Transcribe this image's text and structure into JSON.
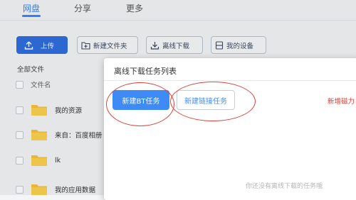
{
  "nav": {
    "tabs": [
      {
        "label": "网盘",
        "active": true
      },
      {
        "label": "分享",
        "active": false
      },
      {
        "label": "更多",
        "active": false
      }
    ]
  },
  "toolbar": {
    "upload": "上传",
    "new_folder": "新建文件夹",
    "offline_download": "离线下载",
    "my_devices": "我的设备"
  },
  "files": {
    "breadcrumb": "全部文件",
    "column_name": "文件名",
    "rows": [
      {
        "name": "我的资源"
      },
      {
        "name": "来自：百度相册"
      },
      {
        "name": "lk"
      },
      {
        "name": "我的应用数据"
      }
    ]
  },
  "dialog": {
    "title": "离线下载任务列表",
    "new_bt_task": "新建BT任务",
    "new_link_task": "新建链接任务",
    "red_hint": "新增磁力",
    "empty_message": "你还没有离线下载的任务哦"
  },
  "colors": {
    "accent": "#3a86ff",
    "primary_button": "#3e8bf6",
    "highlight_red": "#e0403a"
  }
}
